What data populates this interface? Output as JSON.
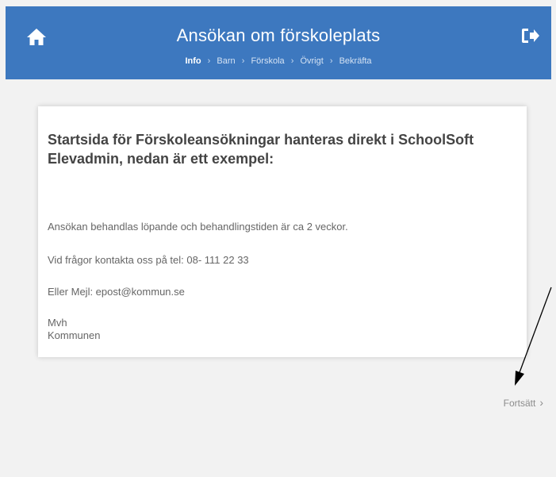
{
  "header": {
    "title": "Ansökan om förskoleplats",
    "home_icon": "home-icon",
    "logout_icon": "logout-icon",
    "background_color": "#3d78bf",
    "breadcrumb": [
      {
        "label": "Info",
        "active": true
      },
      {
        "label": "Barn",
        "active": false
      },
      {
        "label": "Förskola",
        "active": false
      },
      {
        "label": "Övrigt",
        "active": false
      },
      {
        "label": "Bekräfta",
        "active": false
      }
    ],
    "breadcrumb_separator": "›"
  },
  "card": {
    "heading": "Startsida för Förskoleansökningar hanteras direkt i SchoolSoft Elevadmin, nedan är ett exempel:",
    "paragraphs": [
      "Ansökan behandlas löpande och behandlingstiden är ca 2 veckor.",
      "Vid frågor kontakta oss på tel: 08- 111 22 33",
      "Eller Mejl: epost@kommun.se",
      "Mvh",
      "Kommunen"
    ]
  },
  "navigation": {
    "continue_label": "Fortsätt",
    "continue_icon": "chevron-right-icon"
  }
}
